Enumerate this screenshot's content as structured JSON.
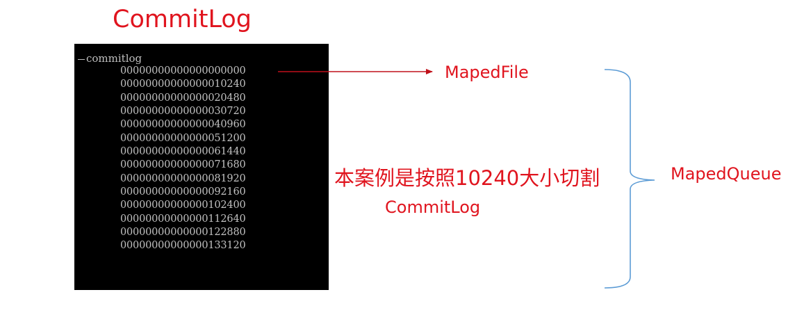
{
  "title": "CommitLog",
  "terminal": {
    "root_folder": "commitlog",
    "files": [
      "00000000000000000000",
      "00000000000000010240",
      "00000000000000020480",
      "00000000000000030720",
      "00000000000000040960",
      "00000000000000051200",
      "00000000000000061440",
      "00000000000000071680",
      "00000000000000081920",
      "00000000000000092160",
      "00000000000000102400",
      "00000000000000112640",
      "00000000000000122880",
      "00000000000000133120"
    ]
  },
  "labels": {
    "maped_file": "MapedFile",
    "maped_queue": "MapedQueue",
    "note": "本案例是按照10240大小切割",
    "note_sub": "CommitLog"
  },
  "colors": {
    "accent_text": "#e0141e",
    "arrow": "#c0111a",
    "brace": "#5b9bd5",
    "terminal_bg": "#000000",
    "terminal_text": "#c0c0c0"
  }
}
